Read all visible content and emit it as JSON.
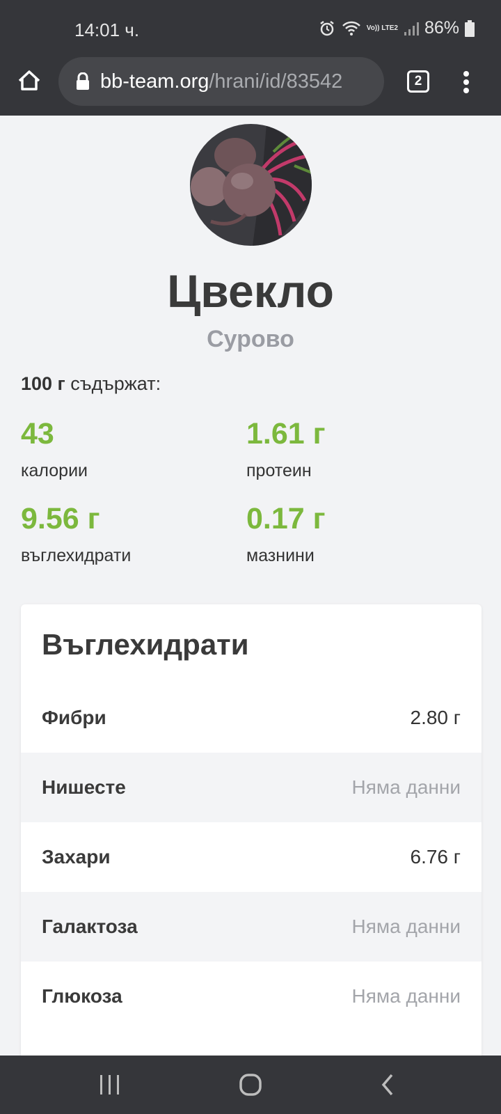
{
  "status_bar": {
    "time": "14:01 ч.",
    "network_label": "Vo)) LTE2",
    "battery": "86%"
  },
  "browser": {
    "url_domain": "bb-team.org",
    "url_path": "/hrani/id/83542",
    "tab_count": "2"
  },
  "food": {
    "title": "Цвекло",
    "subtitle": "Сурово",
    "portion_amount": "100 г",
    "portion_text": " съдържат:"
  },
  "macros": [
    {
      "value": "43",
      "label": "калории"
    },
    {
      "value": "1.61 г",
      "label": "протеин"
    },
    {
      "value": "9.56 г",
      "label": "въглехидрати"
    },
    {
      "value": "0.17 г",
      "label": "мазнини"
    }
  ],
  "carbs_card": {
    "title": "Въглехидрати",
    "rows": [
      {
        "name": "Фибри",
        "value": "2.80 г"
      },
      {
        "name": "Нишесте",
        "value": "Няма данни"
      },
      {
        "name": "Захари",
        "value": "6.76 г"
      },
      {
        "name": "Галактоза",
        "value": "Няма данни"
      },
      {
        "name": "Глюкоза",
        "value": "Няма данни"
      }
    ]
  },
  "colors": {
    "accent_green": "#7cb83d",
    "chrome_dark": "#35363a"
  },
  "icons": [
    "alarm-icon",
    "wifi-icon",
    "signal-icon",
    "battery-icon",
    "home-icon",
    "lock-icon",
    "tabs-icon",
    "more-vert-icon",
    "recents-icon",
    "home-nav-icon",
    "back-icon"
  ]
}
